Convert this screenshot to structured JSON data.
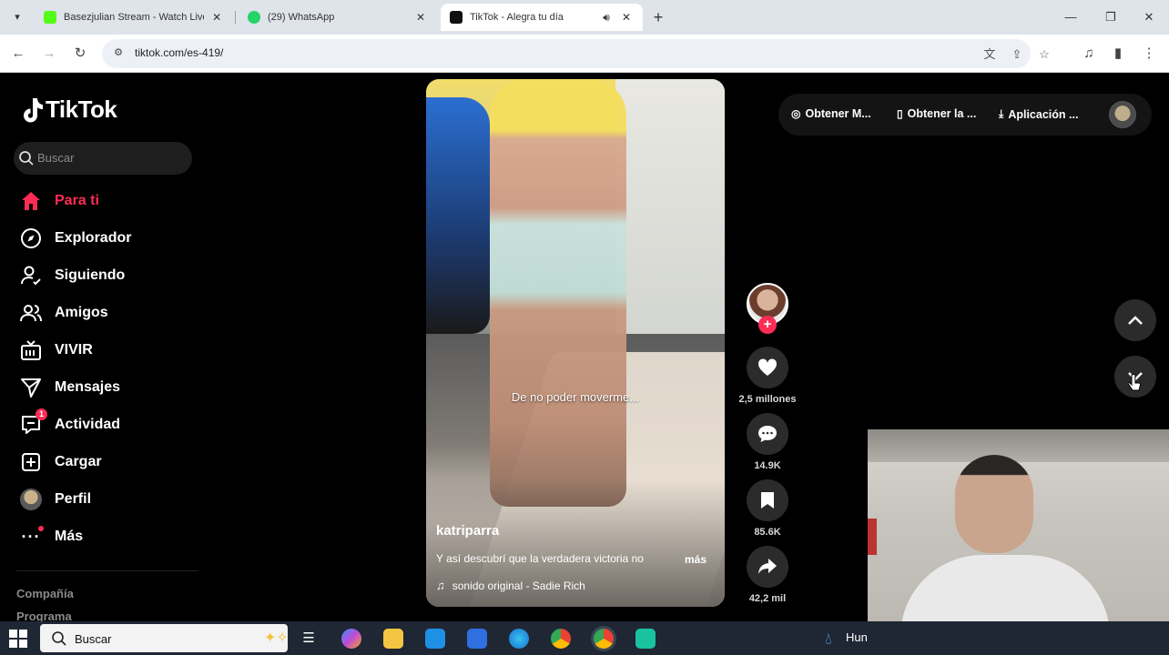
{
  "browser": {
    "tabs": [
      {
        "title": "Basezjulian Stream - Watch Live",
        "favicon_color": "#53fc18"
      },
      {
        "title": "(29) WhatsApp",
        "favicon_color": "#25d366",
        "favicon_text": "29"
      },
      {
        "title": "TikTok - Alegra tu día",
        "favicon_color": "#111111",
        "audio": true
      }
    ],
    "url": "tiktok.com/es-419/"
  },
  "tiktok": {
    "logo": "TikTok",
    "search_placeholder": "Buscar",
    "nav": [
      {
        "label": "Para ti",
        "icon": "home-icon",
        "active": true
      },
      {
        "label": "Explorador",
        "icon": "compass-icon"
      },
      {
        "label": "Siguiendo",
        "icon": "following-icon"
      },
      {
        "label": "Amigos",
        "icon": "friends-icon"
      },
      {
        "label": "VIVIR",
        "icon": "live-icon"
      },
      {
        "label": "Mensajes",
        "icon": "messages-icon"
      },
      {
        "label": "Actividad",
        "icon": "activity-icon",
        "badge": "1"
      },
      {
        "label": "Cargar",
        "icon": "upload-icon"
      },
      {
        "label": "Perfil",
        "icon": "profile-icon"
      },
      {
        "label": "Más",
        "icon": "more-icon",
        "dot": true
      }
    ],
    "footer_links": [
      "Compañía",
      "Programa"
    ],
    "top_actions": [
      {
        "label": "Obtener M...",
        "icon": "coin-icon"
      },
      {
        "label": "Obtener la ...",
        "icon": "phone-icon"
      },
      {
        "label": "Aplicación ...",
        "icon": "download-icon"
      }
    ],
    "video": {
      "overlay_text": "De no poder moverme...",
      "author": "katriparra",
      "description": "Y así descubrí que la verdadera victoria no",
      "more": "más",
      "music": "sonido original - Sadie Rich"
    },
    "actions": {
      "likes": "2,5 millones",
      "comments": "14.9K",
      "saves": "85.6K",
      "shares": "42,2 mil"
    },
    "accent": "#fe2c55"
  },
  "taskbar": {
    "search_placeholder": "Buscar",
    "weather_label": "Hun"
  }
}
